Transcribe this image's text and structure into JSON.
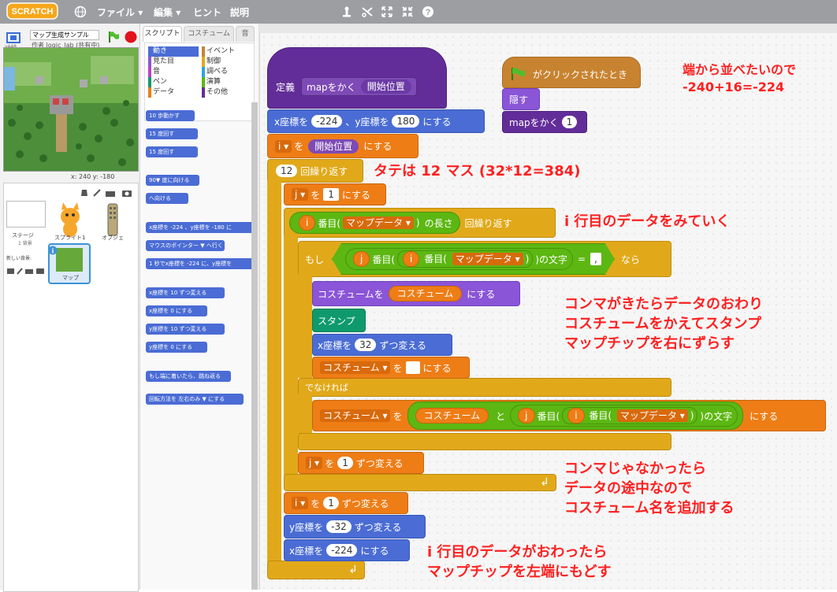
{
  "topbar": {
    "logo": "SCRATCH",
    "menus": [
      "ファイル",
      "編集",
      "ヒント",
      "説明"
    ]
  },
  "stage": {
    "project_title": "マップ生成サンプル",
    "author": "作者 logic_lab (共有中)",
    "version": "v448",
    "coords": "x: 240  y: -180"
  },
  "sprites": {
    "stage_label": "ステージ",
    "stage_sub": "1 背景",
    "new_backdrop": "新しい背景:",
    "items": [
      "スプライト1",
      "オブジェ",
      "マップ"
    ]
  },
  "tabs": [
    "スクリプト",
    "コスチューム",
    "音"
  ],
  "categories": [
    "動き",
    "見た目",
    "音",
    "ペン",
    "データ",
    "イベント",
    "制御",
    "調べる",
    "演算",
    "その他"
  ],
  "palette_blocks": [
    "10 歩動かす",
    "15 度回す",
    "15 度回す",
    "90▼ 度に向ける",
    "へ向ける",
    "x座標を -224 、y座標を -180 に",
    "マウスのポインター ▼ へ行く",
    "1 秒でx座標を -224 に、y座標を",
    "x座標を 10 ずつ変える",
    "x座標を 0 にする",
    "y座標を 10 ずつ変える",
    "y座標を 0 にする",
    "もし端に着いたら、跳ね返る",
    "回転方法を 左右のみ ▼ にする"
  ],
  "script": {
    "define": "定義",
    "proc_name": "mapをかく",
    "param": "開始位置",
    "setxy_a": "x座標を",
    "setxy_x": "-224",
    "setxy_b": "、y座標を",
    "setxy_y": "180",
    "setxy_c": "にする",
    "set_i_var": "i",
    "set_i_to": "を",
    "set_i_val": "開始位置",
    "set_i_end": "にする",
    "repeat_n": "12",
    "repeat_label": "回繰り返す",
    "set_j_var": "j",
    "set_j_to": "を",
    "set_j_val": "1",
    "set_j_end": "にする",
    "ru_i": "i",
    "ru_nth": "番目(",
    "ru_list": "マップデータ",
    "ru_len": "の長さ",
    "ru_end": "回繰り返す",
    "if_label": "もし",
    "if_j": "j",
    "if_nth": "番目(",
    "if_i": "i",
    "if_nth2": "番目(",
    "if_list": "マップデータ",
    "if_char": ")の文字",
    "if_eq": "=",
    "if_val": ",",
    "if_then": "なら",
    "sc_a": "コスチュームを",
    "sc_var": "コスチューム",
    "sc_b": "にする",
    "stamp": "スタンプ",
    "cx_a": "x座標を",
    "cx_val": "32",
    "cx_b": "ずつ変える",
    "scv_var": "コスチューム",
    "scv_to": "を",
    "scv_end": "にする",
    "else": "でなければ",
    "sc2_var": "コスチューム",
    "sc2_to": "を",
    "sc2_join_a": "コスチューム",
    "sc2_and": "と",
    "sc2_j": "j",
    "sc2_nth": "番目(",
    "sc2_i": "i",
    "sc2_nth2": "番目(",
    "sc2_list": "マップデータ",
    "sc2_char": ")の文字",
    "sc2_end": "にする",
    "cj_var": "j",
    "cj_a": "を",
    "cj_val": "1",
    "cj_b": "ずつ変える",
    "ci_var": "i",
    "ci_a": "を",
    "ci_val": "1",
    "ci_b": "ずつ変える",
    "cy_a": "y座標を",
    "cy_val": "-32",
    "cy_b": "ずつ変える",
    "sx_a": "x座標を",
    "sx_val": "-224",
    "sx_b": "にする",
    "hat": "がクリックされたとき",
    "hide": "隠す",
    "call_name": "mapをかく",
    "call_arg": "1"
  },
  "notes": {
    "n1": [
      "端から並べたいので",
      "-240+16=-224"
    ],
    "n2": "タテは 12 マス (32*12=384)",
    "n3": "i 行目のデータをみていく",
    "n4": [
      "コンマがきたらデータのおわり",
      "コスチュームをかえてスタンプ",
      "マップチップを右にずらす"
    ],
    "n5": [
      "コンマじゃなかったら",
      "データの途中なので",
      "コスチューム名を追加する"
    ],
    "n6": [
      "i 行目のデータがおわったら",
      "マップチップを左端にもどす"
    ]
  },
  "colors": {
    "motion": "#4a6cd4",
    "control": "#e1a91a",
    "looks": "#8a55d7",
    "pen": "#0e9a6c",
    "data": "#ee7d16",
    "ops": "#5cb712",
    "more": "#632d99",
    "note": "#ff2020"
  }
}
